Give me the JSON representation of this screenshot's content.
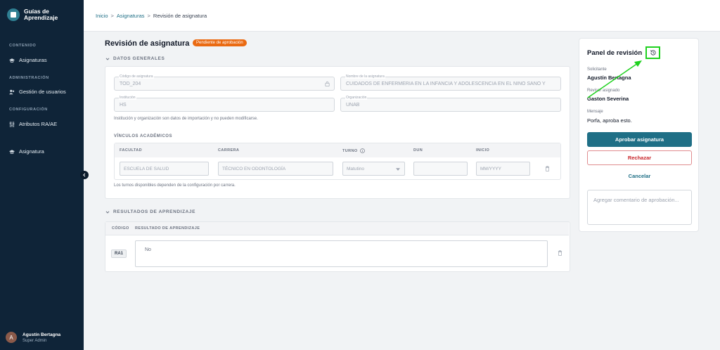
{
  "app": {
    "name": "Guías de Aprendizaje"
  },
  "sidebar": {
    "sections": [
      {
        "title": "CONTENIDO"
      },
      {
        "title": "ADMINISTRACIÓN"
      },
      {
        "title": "CONFIGURACIÓN"
      }
    ],
    "items": [
      {
        "label": "Asignaturas",
        "icon": "graduation-cap-icon"
      },
      {
        "label": "Gestión de usuarios",
        "icon": "users-icon"
      },
      {
        "label": "Atributos RA/AE",
        "icon": "sliders-icon"
      },
      {
        "label": "Asignatura",
        "icon": "graduation-cap-icon"
      }
    ],
    "user": {
      "initial": "A",
      "name": "Agustín Bertagna",
      "role": "Super Admin"
    }
  },
  "breadcrumb": {
    "home": "Inicio",
    "sep": ">",
    "parent": "Asignaturas",
    "current": "Revisión de asignatura"
  },
  "page": {
    "title": "Revisión de asignatura",
    "status": "Pendiente de aprobación"
  },
  "general": {
    "heading": "DATOS GENERALES",
    "codigo": {
      "label": "Código de asignatura",
      "value": "TOD_204"
    },
    "nombre": {
      "label": "Nombre de la asignatura",
      "value": "CUIDADOS DE ENFERMERÍA EN LA INFANCIA Y ADOLESCENCIA EN EL NIÑO SANO Y"
    },
    "institucion": {
      "label": "Institución",
      "value": "HS"
    },
    "organizacion": {
      "label": "Organización",
      "value": "UNAB"
    },
    "hint": "Institución y organización son datos de importación y no pueden modificarse.",
    "vinculos": {
      "title": "VÍNCULOS ACADÉMICOS",
      "columns": [
        "FACULTAD",
        "CARRERA",
        "TURNO",
        "DUN",
        "INICIO"
      ],
      "row": {
        "facultad": "ESCUELA DE SALUD",
        "carrera": "TÉCNICO EN ODONTOLOGÍA",
        "turno": "Matutino",
        "dun": "",
        "inicio": "MM/YYYY"
      },
      "hint": "Los turnos disponibles dependen de la configuración por carrera."
    }
  },
  "resultados": {
    "heading": "RESULTADOS DE APRENDIZAJE",
    "columns": [
      "CÓDIGO",
      "RESULTADO DE APRENDIZAJE"
    ],
    "rows": [
      {
        "code": "RA1",
        "text": "No"
      }
    ]
  },
  "review": {
    "title": "Panel de revisión",
    "solicitante_label": "Solicitante",
    "solicitante": "Agustín Bertagna",
    "revisor_label": "Revisor asignado",
    "revisor": "Gaston Severina",
    "mensaje_label": "Mensaje",
    "mensaje": "Porfa, aproba esto.",
    "approve": "Aprobar asignatura",
    "reject": "Rechazar",
    "cancel": "Cancelar",
    "comment_placeholder": "Agregar comentario de aprobación..."
  },
  "colors": {
    "sidebar": "#0f2438",
    "accent": "#1f6f86",
    "status": "#ea6a12",
    "reject": "#c9262b",
    "highlight": "#1fd11f"
  }
}
